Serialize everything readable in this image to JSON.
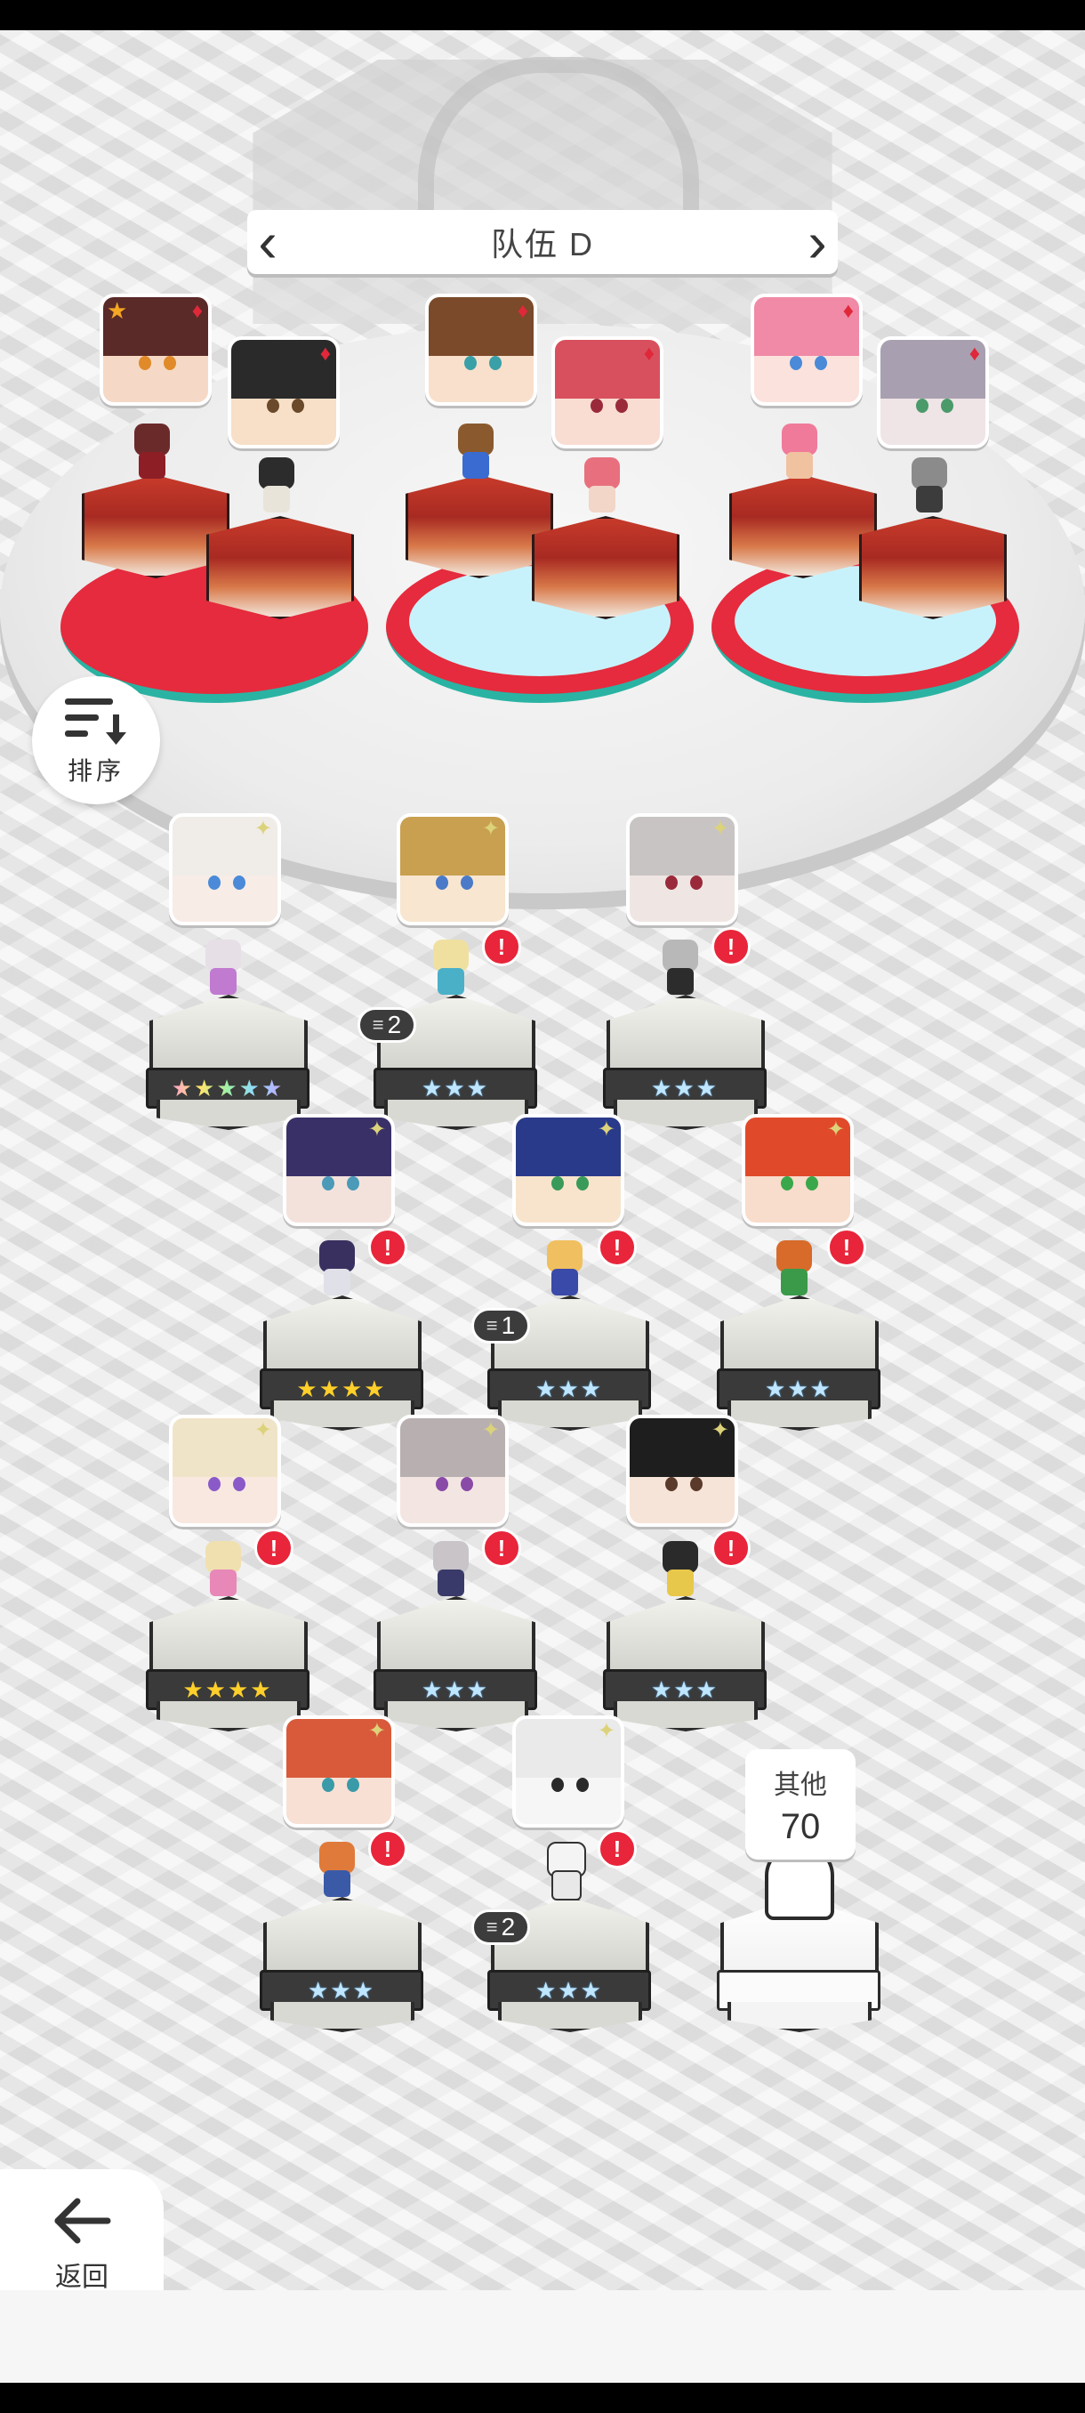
{
  "team": {
    "name": "队伍 D",
    "prev_icon": "chevron-left-icon",
    "next_icon": "chevron-right-icon",
    "members": [
      {
        "slot": 1,
        "badge": "star",
        "suit": "♦",
        "favorite": true
      },
      {
        "slot": 2,
        "suit": "♦"
      },
      {
        "slot": 3,
        "suit": "♦"
      },
      {
        "slot": 4,
        "suit": "♦"
      },
      {
        "slot": 5,
        "suit": "♦"
      },
      {
        "slot": 6,
        "suit": "♦"
      }
    ]
  },
  "sort_button": {
    "label": "排序",
    "icon": "sort-icon"
  },
  "roster": [
    {
      "row": 1,
      "stars": "★★★★★",
      "rarity": "rainbow",
      "alert": false,
      "dup": null
    },
    {
      "row": 1,
      "stars": "★★★",
      "rarity": "blue",
      "alert": true,
      "dup": "2"
    },
    {
      "row": 1,
      "stars": "★★★",
      "rarity": "blue",
      "alert": true,
      "dup": null
    },
    {
      "row": 2,
      "stars": "★★★★",
      "rarity": "gold",
      "alert": true,
      "dup": null
    },
    {
      "row": 2,
      "stars": "★★★",
      "rarity": "blue",
      "alert": true,
      "dup": "1"
    },
    {
      "row": 2,
      "stars": "★★★",
      "rarity": "blue",
      "alert": true,
      "dup": null
    },
    {
      "row": 3,
      "stars": "★★★★",
      "rarity": "gold",
      "alert": true,
      "dup": null
    },
    {
      "row": 3,
      "stars": "★★★",
      "rarity": "blue",
      "alert": true,
      "dup": null
    },
    {
      "row": 3,
      "stars": "★★★",
      "rarity": "blue",
      "alert": true,
      "dup": null
    },
    {
      "row": 4,
      "stars": "★★★",
      "rarity": "blue",
      "alert": true,
      "dup": null
    },
    {
      "row": 4,
      "stars": "★★★",
      "rarity": "blue",
      "alert": true,
      "dup": "2"
    }
  ],
  "others": {
    "label": "其他",
    "count": "70"
  },
  "back_button": {
    "label": "返回",
    "icon": "arrow-left-icon"
  },
  "alert_glyph": "!",
  "colors": {
    "accent_red": "#e8253a",
    "pad_red": "#e52b3d",
    "pad_teal": "#2ab3a3"
  }
}
